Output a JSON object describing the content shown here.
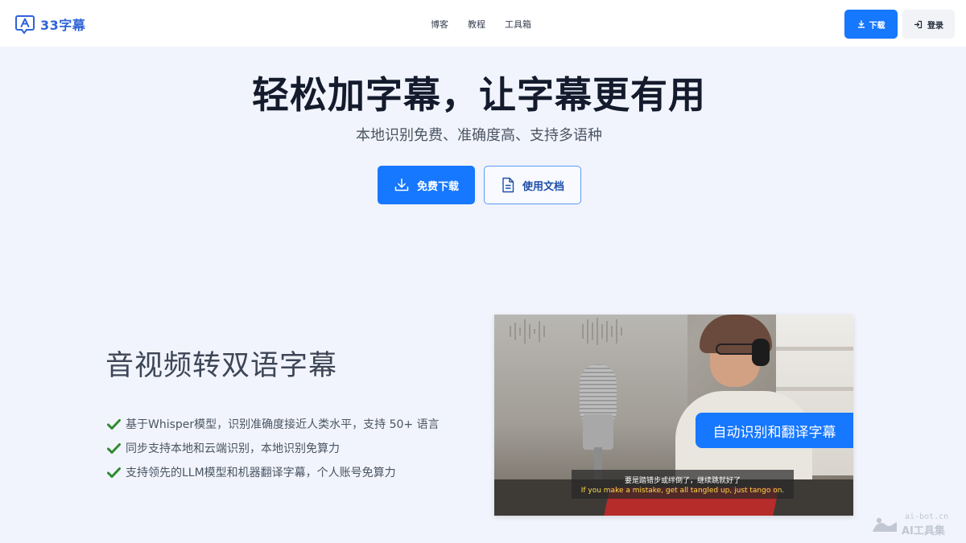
{
  "header": {
    "logo_text": "33字幕",
    "nav": [
      {
        "label": "博客"
      },
      {
        "label": "教程"
      },
      {
        "label": "工具箱"
      }
    ],
    "download_label": "下载",
    "login_label": "登录"
  },
  "hero": {
    "title": "轻松加字幕，让字幕更有用",
    "subtitle": "本地识别免费、准确度高、支持多语种",
    "free_download_label": "免费下载",
    "docs_label": "使用文档"
  },
  "feature": {
    "title": "音视频转双语字幕",
    "items": [
      {
        "text": "基于Whisper模型，识别准确度接近人类水平，支持 50+ 语言"
      },
      {
        "text": "同步支持本地和云端识别，本地识别免算力"
      },
      {
        "text": "支持领先的LLM模型和机器翻译字幕，个人账号免算力"
      }
    ]
  },
  "video": {
    "overlay_label": "自动识别和翻译字幕",
    "subtitle_cn": "要是踏错步或绊倒了，继续跳就好了",
    "subtitle_en": "If you make a mistake, get all tangled up, just tango on."
  },
  "watermark": {
    "top": "ai-bot.cn",
    "bottom": "AI工具集"
  },
  "colors": {
    "accent": "#1677ff",
    "background": "#f1f4fc",
    "check": "#2e8b2e"
  },
  "icons": {
    "download": "download-icon",
    "login": "login-icon",
    "document": "document-icon",
    "check": "check-icon"
  }
}
